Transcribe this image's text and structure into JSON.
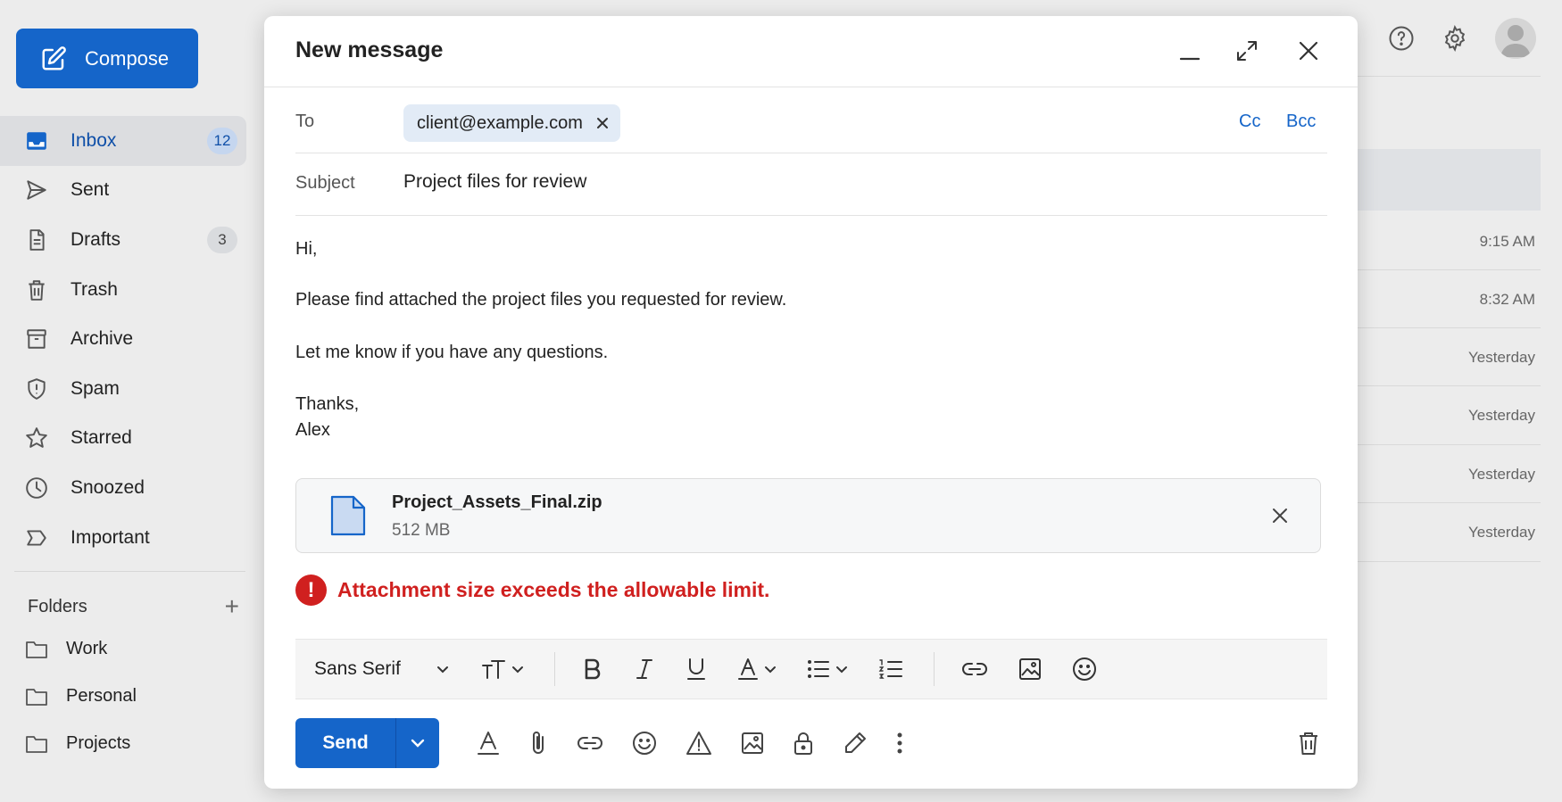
{
  "sidebar": {
    "compose_label": "Compose",
    "items": [
      {
        "label": "Inbox",
        "count": "12",
        "icon": "inbox-icon"
      },
      {
        "label": "Sent",
        "count": "",
        "icon": "send-icon"
      },
      {
        "label": "Drafts",
        "count": "3",
        "icon": "draft-icon"
      },
      {
        "label": "Trash",
        "count": "",
        "icon": "trash-icon"
      },
      {
        "label": "Archive",
        "count": "",
        "icon": "archive-icon"
      },
      {
        "label": "Spam",
        "count": "",
        "icon": "shield-icon"
      },
      {
        "label": "Starred",
        "count": "",
        "icon": "star-icon"
      },
      {
        "label": "Snoozed",
        "count": "",
        "icon": "clock-icon"
      },
      {
        "label": "Important",
        "count": "",
        "icon": "label-icon"
      }
    ],
    "folders_label": "Folders",
    "folders": [
      "Work",
      "Personal",
      "Projects"
    ]
  },
  "background_list": {
    "times": [
      "9:15 AM",
      "8:32 AM",
      "Yesterday",
      "Yesterday",
      "Yesterday",
      "Yesterday"
    ]
  },
  "compose": {
    "title": "New message",
    "to_label": "To",
    "recipient": "client@example.com",
    "cc_label": "Cc",
    "bcc_label": "Bcc",
    "subject_label": "Subject",
    "subject": "Project files for review",
    "body": {
      "greeting": "Hi,",
      "line1": "Please find attached the project files you requested for review.",
      "line2": "Let me know if you have any questions.",
      "signoff": "Thanks,",
      "name": "Alex"
    },
    "attachment": {
      "name": "Project_Assets_Final.zip",
      "size": "512 MB"
    },
    "error": "Attachment size exceeds the allowable limit.",
    "font_family": "Sans Serif",
    "send_label": "Send"
  },
  "colors": {
    "accent": "#1565c9",
    "error": "#d0201f",
    "chip_bg": "#e2ebf6"
  }
}
